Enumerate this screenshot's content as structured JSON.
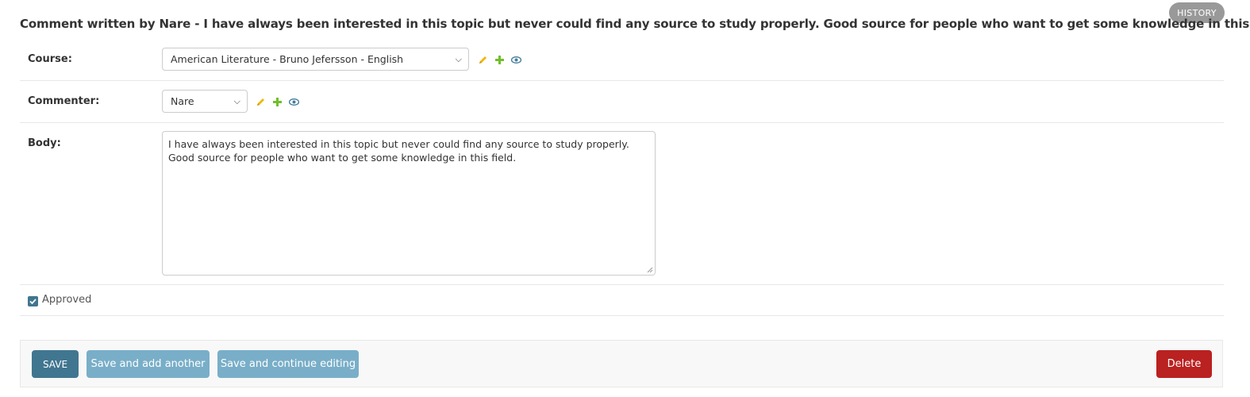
{
  "header": {
    "history_label": "HISTORY",
    "title": "Comment written by Nare - I have always been interested in this topic but never could find any source to study properly. Good source for people who want to get some knowledge in this field."
  },
  "form": {
    "course": {
      "label": "Course:",
      "value": "American Literature - Bruno Jefersson - English",
      "icons": [
        "pencil-icon",
        "plus-icon",
        "eye-icon"
      ]
    },
    "commenter": {
      "label": "Commenter:",
      "value": "Nare",
      "icons": [
        "pencil-icon",
        "plus-icon",
        "eye-icon"
      ]
    },
    "body": {
      "label": "Body:",
      "value": "I have always been interested in this topic but never could find any source to study properly. Good source for people who want to get some knowledge in this field."
    },
    "approved": {
      "label": "Approved",
      "checked": true
    }
  },
  "actions": {
    "save": "SAVE",
    "save_add": "Save and add another",
    "save_continue": "Save and continue editing",
    "delete": "Delete"
  },
  "colors": {
    "primary": "#417690",
    "secondary": "#79aec8",
    "danger": "#ba2121",
    "pencil": "#efb80b",
    "plus": "#70bf2b",
    "eye": "#447e9b"
  }
}
